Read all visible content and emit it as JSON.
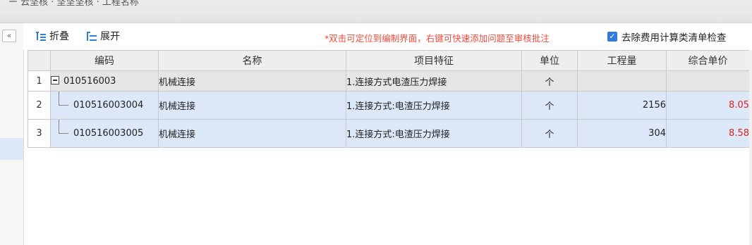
{
  "topbar": {
    "breadcrumb": "ー 云坚核 · 坚坚坚核 · 工程名称"
  },
  "toolbar": {
    "collapse_label": "折叠",
    "expand_label": "展开",
    "notice": "*双击可定位到编制界面，右键可快速添加问题至审核批注",
    "checkbox_label": "去除费用计算类清单检查",
    "checkbox_checked": true
  },
  "left_panel": {
    "collapse_glyph": "«"
  },
  "table": {
    "headers": [
      "",
      "编码",
      "名称",
      "项目特征",
      "单位",
      "工程量",
      "综合单价"
    ],
    "rows": [
      {
        "num": "1",
        "code": "010516003",
        "name": "机械连接",
        "feature": "1.连接方式电渣压力焊接",
        "unit": "个",
        "qty": "",
        "price": ""
      },
      {
        "num": "2",
        "code": "010516003004",
        "name": "机械连接",
        "feature": "1.连接方式:电渣压力焊接",
        "unit": "个",
        "qty": "2156",
        "price": "8.05"
      },
      {
        "num": "3",
        "code": "010516003005",
        "name": "机械连接",
        "feature": "1.连接方式:电渣压力焊接",
        "unit": "个",
        "qty": "304",
        "price": "8.58"
      }
    ]
  },
  "colors": {
    "accent": "#2f7be0",
    "notice": "#f04a3c",
    "price_red": "#e0201f",
    "selected_row": "#dce8f8"
  }
}
